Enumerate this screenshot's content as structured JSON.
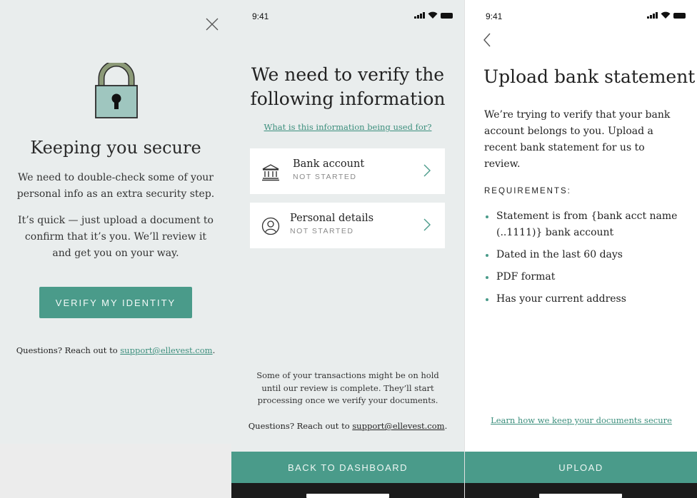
{
  "screen1": {
    "title": "Keeping you secure",
    "paragraph1": "We need to double-check some of your personal info as an extra security step.",
    "paragraph2": "It’s quick — just upload a document to confirm that it’s you. We’ll review it and get you on your way.",
    "verify_button": "VERIFY MY IDENTITY",
    "questions_prefix": "Questions? Reach out to ",
    "support_email": "support@ellevest.com",
    "questions_suffix": "."
  },
  "screen2": {
    "status_time": "9:41",
    "title": "We need to verify the following information",
    "info_link": "What is this information being used for?",
    "items": [
      {
        "label": "Bank account",
        "status": "NOT STARTED"
      },
      {
        "label": "Personal details",
        "status": "NOT STARTED"
      }
    ],
    "note": "Some of your transactions might be on hold until our review is complete. They’ll start processing once we verify your documents.",
    "questions_prefix": "Questions? Reach out to ",
    "support_email": "support@ellevest.com",
    "questions_suffix": ".",
    "bottom_button": "BACK TO DASHBOARD"
  },
  "screen3": {
    "status_time": "9:41",
    "title": "Upload bank statement",
    "description": "We’re trying to verify that your bank account belongs to you. Upload a recent bank statement for us to review.",
    "requirements_heading": "REQUIREMENTS:",
    "requirements": [
      "Statement is from {bank acct name (..1111)} bank account",
      "Dated in the last 60 days",
      "PDF format",
      "Has your current address"
    ],
    "secure_link": "Learn how we keep your documents secure",
    "bottom_button": "UPLOAD"
  },
  "colors": {
    "accent": "#4a9b8a",
    "panel_bg": "#e9eded",
    "lock_body": "#9fc6bf",
    "lock_shackle": "#8c9a78"
  },
  "icons": {
    "close": "close-icon",
    "lock": "lock-icon",
    "bank": "bank-icon",
    "person": "person-icon",
    "chevron": "chevron-right-icon",
    "back": "chevron-left-icon"
  }
}
